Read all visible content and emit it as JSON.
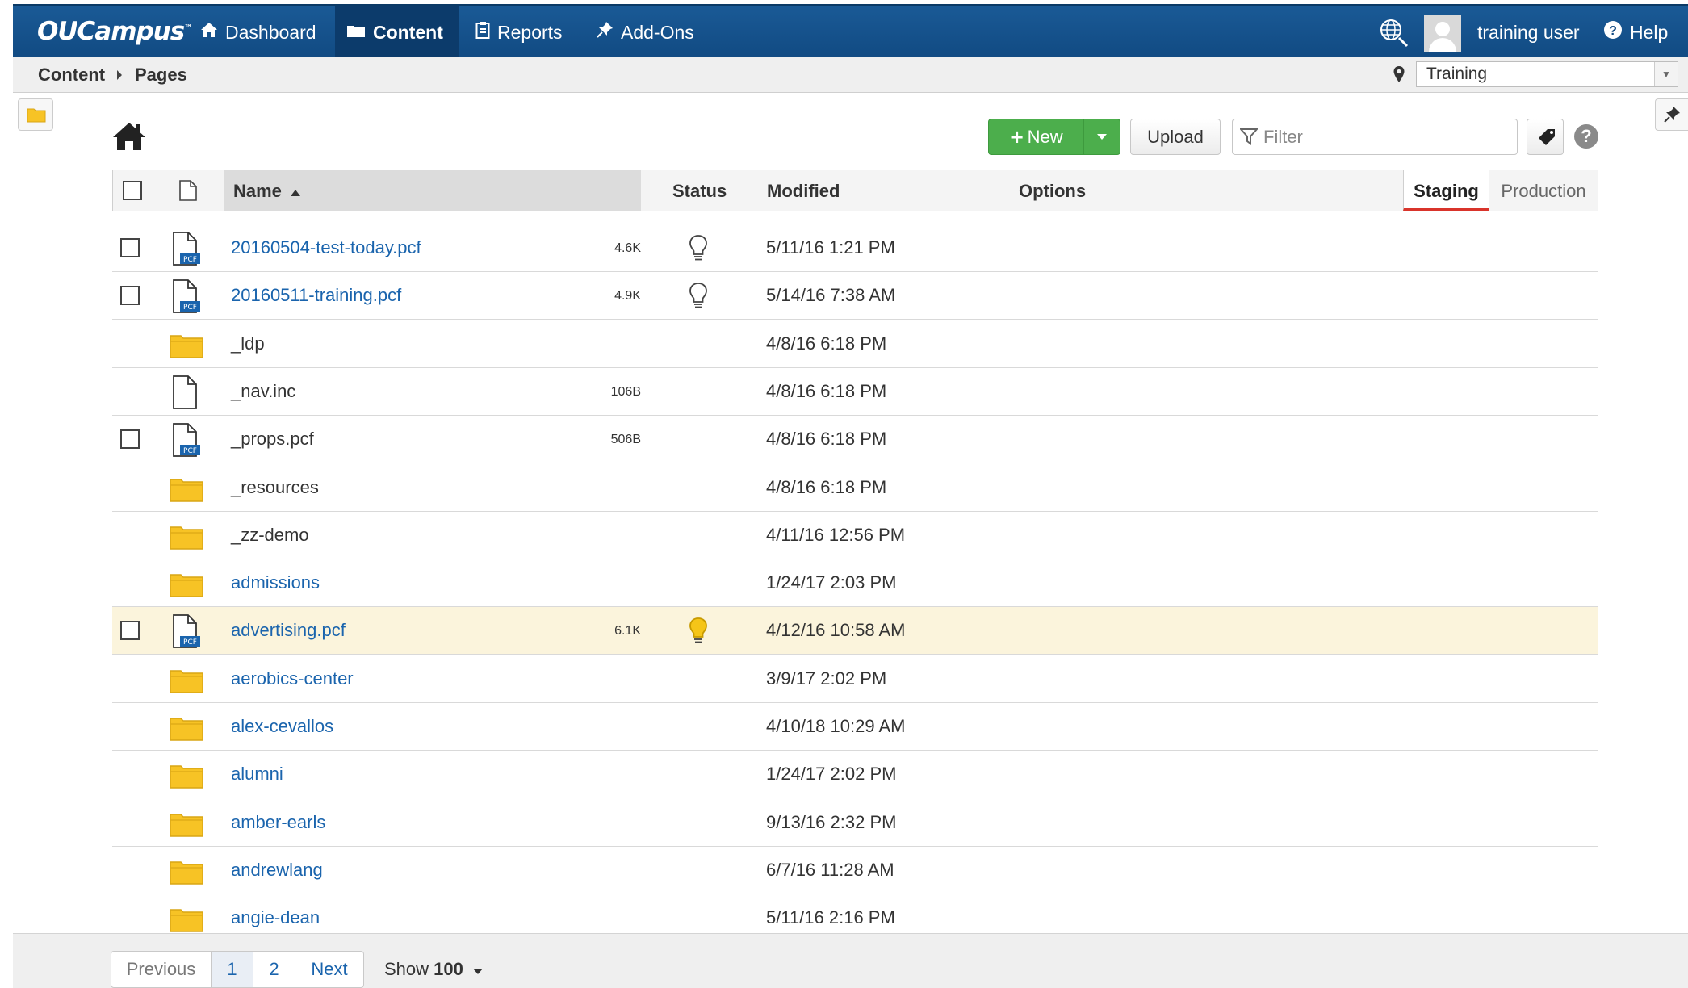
{
  "nav": {
    "logo": "OUCampus",
    "items": [
      {
        "label": "Dashboard",
        "icon": "home-icon"
      },
      {
        "label": "Content",
        "icon": "folder-icon"
      },
      {
        "label": "Reports",
        "icon": "clipboard-icon"
      },
      {
        "label": "Add-Ons",
        "icon": "pin-icon"
      }
    ],
    "user": "training user",
    "help": "Help"
  },
  "breadcrumb": {
    "root": "Content",
    "current": "Pages"
  },
  "site_selector": {
    "value": "Training"
  },
  "toolbar": {
    "new_label": "New",
    "upload_label": "Upload",
    "filter_placeholder": "Filter"
  },
  "table": {
    "headers": {
      "name": "Name",
      "status": "Status",
      "modified": "Modified",
      "options": "Options"
    },
    "env_tabs": {
      "staging": "Staging",
      "production": "Production"
    },
    "rows": [
      {
        "name": "20160504-test-today.pcf",
        "type": "pcf",
        "size": "4.6K",
        "status": "unpublished",
        "modified": "5/11/16 1:21 PM"
      },
      {
        "name": "20160511-training.pcf",
        "type": "pcf",
        "size": "4.9K",
        "status": "unpublished",
        "modified": "5/14/16 7:38 AM"
      },
      {
        "name": "_ldp",
        "type": "folder",
        "size": "",
        "status": "",
        "modified": "4/8/16 6:18 PM"
      },
      {
        "name": "_nav.inc",
        "type": "file",
        "size": "106B",
        "status": "",
        "modified": "4/8/16 6:18 PM"
      },
      {
        "name": "_props.pcf",
        "type": "pcf",
        "size": "506B",
        "status": "",
        "modified": "4/8/16 6:18 PM"
      },
      {
        "name": "_resources",
        "type": "folder",
        "size": "",
        "status": "",
        "modified": "4/8/16 6:18 PM"
      },
      {
        "name": "_zz-demo",
        "type": "folder",
        "size": "",
        "status": "",
        "modified": "4/11/16 12:56 PM"
      },
      {
        "name": "admissions",
        "type": "folder",
        "size": "",
        "status": "",
        "modified": "1/24/17 2:03 PM"
      },
      {
        "name": "advertising.pcf",
        "type": "pcf",
        "size": "6.1K",
        "status": "published",
        "modified": "4/12/16 10:58 AM"
      },
      {
        "name": "aerobics-center",
        "type": "folder",
        "size": "",
        "status": "",
        "modified": "3/9/17 2:02 PM"
      },
      {
        "name": "alex-cevallos",
        "type": "folder",
        "size": "",
        "status": "",
        "modified": "4/10/18 10:29 AM"
      },
      {
        "name": "alumni",
        "type": "folder",
        "size": "",
        "status": "",
        "modified": "1/24/17 2:02 PM"
      },
      {
        "name": "amber-earls",
        "type": "folder",
        "size": "",
        "status": "",
        "modified": "9/13/16 2:32 PM"
      },
      {
        "name": "andrewlang",
        "type": "folder",
        "size": "",
        "status": "",
        "modified": "6/7/16 11:28 AM"
      },
      {
        "name": "angie-dean",
        "type": "folder",
        "size": "",
        "status": "",
        "modified": "5/11/16 2:16 PM"
      }
    ]
  },
  "pagination": {
    "previous": "Previous",
    "pages": [
      "1",
      "2"
    ],
    "next": "Next",
    "show_label": "Show",
    "show_value": "100"
  },
  "colors": {
    "nav_bg": "#1a5a96",
    "link": "#1a64ad",
    "new_button": "#4cae4c",
    "folder": "#f7c325",
    "highlight_row": "#fbf4dc",
    "staging_underline": "#d9342b"
  }
}
